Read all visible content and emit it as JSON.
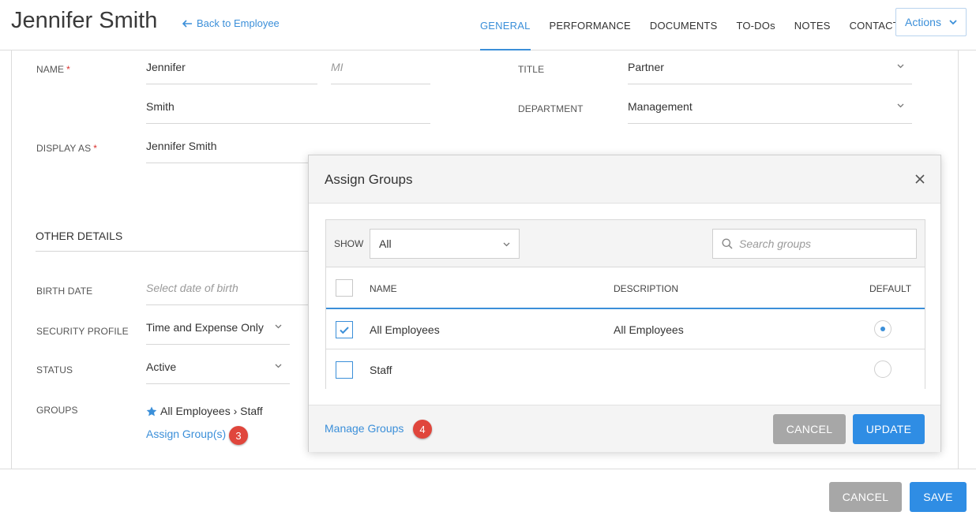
{
  "header": {
    "employee_name": "Jennifer Smith",
    "back_label": "Back to Employee",
    "tabs": [
      {
        "label": "GENERAL",
        "active": true
      },
      {
        "label": "PERFORMANCE"
      },
      {
        "label": "DOCUMENTS"
      },
      {
        "label": "TO-DOs"
      },
      {
        "label": "NOTES"
      },
      {
        "label": "CONTACTS"
      }
    ],
    "actions_label": "Actions"
  },
  "form": {
    "name_label": "NAME",
    "required_mark": "*",
    "first_name": "Jennifer",
    "mi_placeholder": "MI",
    "last_name": "Smith",
    "title_label": "TITLE",
    "title_value": "Partner",
    "department_label": "DEPARTMENT",
    "department_value": "Management",
    "display_as_label": "DISPLAY AS",
    "display_as_value": "Jennifer Smith",
    "other_details_title": "OTHER DETAILS",
    "birth_date_label": "BIRTH DATE",
    "birth_date_placeholder": "Select date of birth",
    "security_profile_label": "SECURITY PROFILE",
    "security_profile_value": "Time and Expense Only",
    "status_label": "STATUS",
    "status_value": "Active",
    "groups_label": "GROUPS",
    "groups_value": "All Employees › Staff",
    "assign_groups_link": "Assign Group(s)",
    "badge_3": "3"
  },
  "footer": {
    "cancel_label": "CANCEL",
    "save_label": "SAVE"
  },
  "modal": {
    "title": "Assign Groups",
    "show_label": "SHOW",
    "show_value": "All",
    "search_placeholder": "Search groups",
    "columns": {
      "name": "NAME",
      "description": "DESCRIPTION",
      "default": "DEFAULT"
    },
    "rows": [
      {
        "name": "All Employees",
        "description": "All Employees",
        "checked": true,
        "default": true
      },
      {
        "name": "Staff",
        "description": "",
        "checked": false,
        "default": false
      }
    ],
    "manage_groups_link": "Manage Groups",
    "badge_4": "4",
    "cancel_label": "CANCEL",
    "update_label": "UPDATE"
  },
  "colors": {
    "accent": "#3b8fd9",
    "primary_button": "#2f8de4",
    "secondary_button": "#a7a7a7",
    "badge": "#e0463c",
    "required": "#d9302c"
  }
}
